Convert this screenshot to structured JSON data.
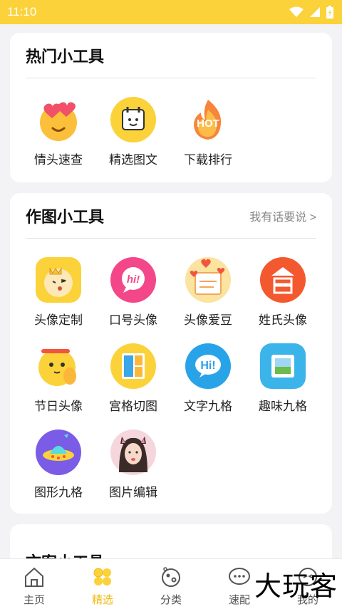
{
  "status": {
    "time": "11:10"
  },
  "hot": {
    "title": "热门小工具",
    "items": [
      {
        "label": "情头速查",
        "icon": "heart-eyes-icon"
      },
      {
        "label": "精选图文",
        "icon": "calendar-icon"
      },
      {
        "label": "下载排行",
        "icon": "hot-flame-icon"
      }
    ]
  },
  "drawing": {
    "title": "作图小工具",
    "more": "我有话要说 >",
    "items": [
      {
        "label": "头像定制",
        "icon": "crown-face-icon"
      },
      {
        "label": "口号头像",
        "icon": "hi-bubble-icon"
      },
      {
        "label": "头像爱豆",
        "icon": "hearts-card-icon"
      },
      {
        "label": "姓氏头像",
        "icon": "surname-icon"
      },
      {
        "label": "节日头像",
        "icon": "holiday-face-icon"
      },
      {
        "label": "宫格切图",
        "icon": "grid-cut-icon"
      },
      {
        "label": "文字九格",
        "icon": "hi-chat-icon"
      },
      {
        "label": "趣味九格",
        "icon": "stamp-icon"
      },
      {
        "label": "图形九格",
        "icon": "ufo-icon"
      },
      {
        "label": "图片编辑",
        "icon": "photo-portrait-icon"
      }
    ]
  },
  "copy": {
    "title": "文案小工具"
  },
  "tabs": [
    {
      "label": "主页",
      "icon": "home-icon"
    },
    {
      "label": "精选",
      "icon": "clover-icon"
    },
    {
      "label": "分类",
      "icon": "category-icon"
    },
    {
      "label": "速配",
      "icon": "chat-icon"
    },
    {
      "label": "我的",
      "icon": "face-icon"
    }
  ],
  "watermark": "大玩客",
  "colors": {
    "accent": "#fbd23a",
    "active_tab": "#f0b80c"
  }
}
